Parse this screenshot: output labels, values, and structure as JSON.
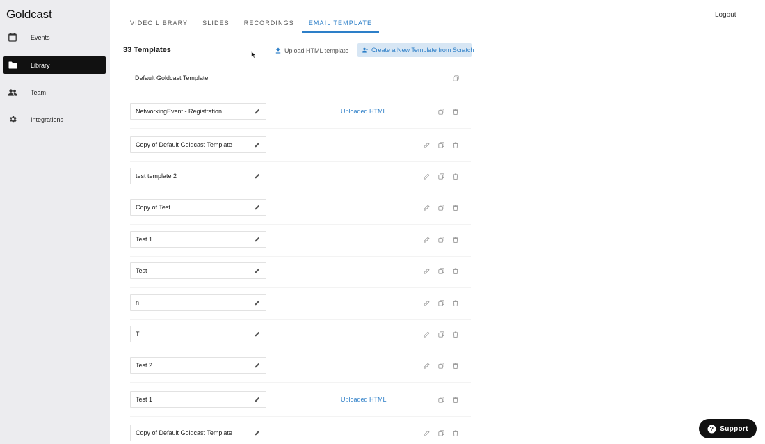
{
  "sidebar": {
    "brand": "Goldcast",
    "items": [
      {
        "label": "Events",
        "icon": "calendar-icon",
        "active": false
      },
      {
        "label": "Library",
        "icon": "folder-icon",
        "active": true
      },
      {
        "label": "Team",
        "icon": "people-icon",
        "active": false
      },
      {
        "label": "Integrations",
        "icon": "gear-icon",
        "active": false
      }
    ]
  },
  "header": {
    "tabs": [
      {
        "label": "VIDEO LIBRARY",
        "active": false
      },
      {
        "label": "SLIDES",
        "active": false
      },
      {
        "label": "RECORDINGS",
        "active": false
      },
      {
        "label": "EMAIL TEMPLATE",
        "active": true
      }
    ],
    "logout_label": "Logout"
  },
  "toolbar": {
    "count_label": "33 Templates",
    "upload_label": "Upload HTML template",
    "create_label": "Create a New Template from Scratch"
  },
  "templates": [
    {
      "name": "Default Goldcast Template",
      "tag": ""
    },
    {
      "name": "NetworkingEvent - Registration",
      "tag": "Uploaded HTML"
    },
    {
      "name": "Copy of Default Goldcast Template",
      "tag": ""
    },
    {
      "name": "test template 2",
      "tag": ""
    },
    {
      "name": "Copy of Test",
      "tag": ""
    },
    {
      "name": "Test 1",
      "tag": ""
    },
    {
      "name": "Test",
      "tag": ""
    },
    {
      "name": "n",
      "tag": ""
    },
    {
      "name": "T",
      "tag": ""
    },
    {
      "name": "Test 2",
      "tag": ""
    },
    {
      "name": "Test 1",
      "tag": "Uploaded HTML"
    },
    {
      "name": "Copy of Default Goldcast Template",
      "tag": ""
    }
  ],
  "support": {
    "label": "Support"
  },
  "colors": {
    "accent": "#2d7fc8",
    "sidebar_bg": "#ececef",
    "active_nav": "#111111"
  }
}
